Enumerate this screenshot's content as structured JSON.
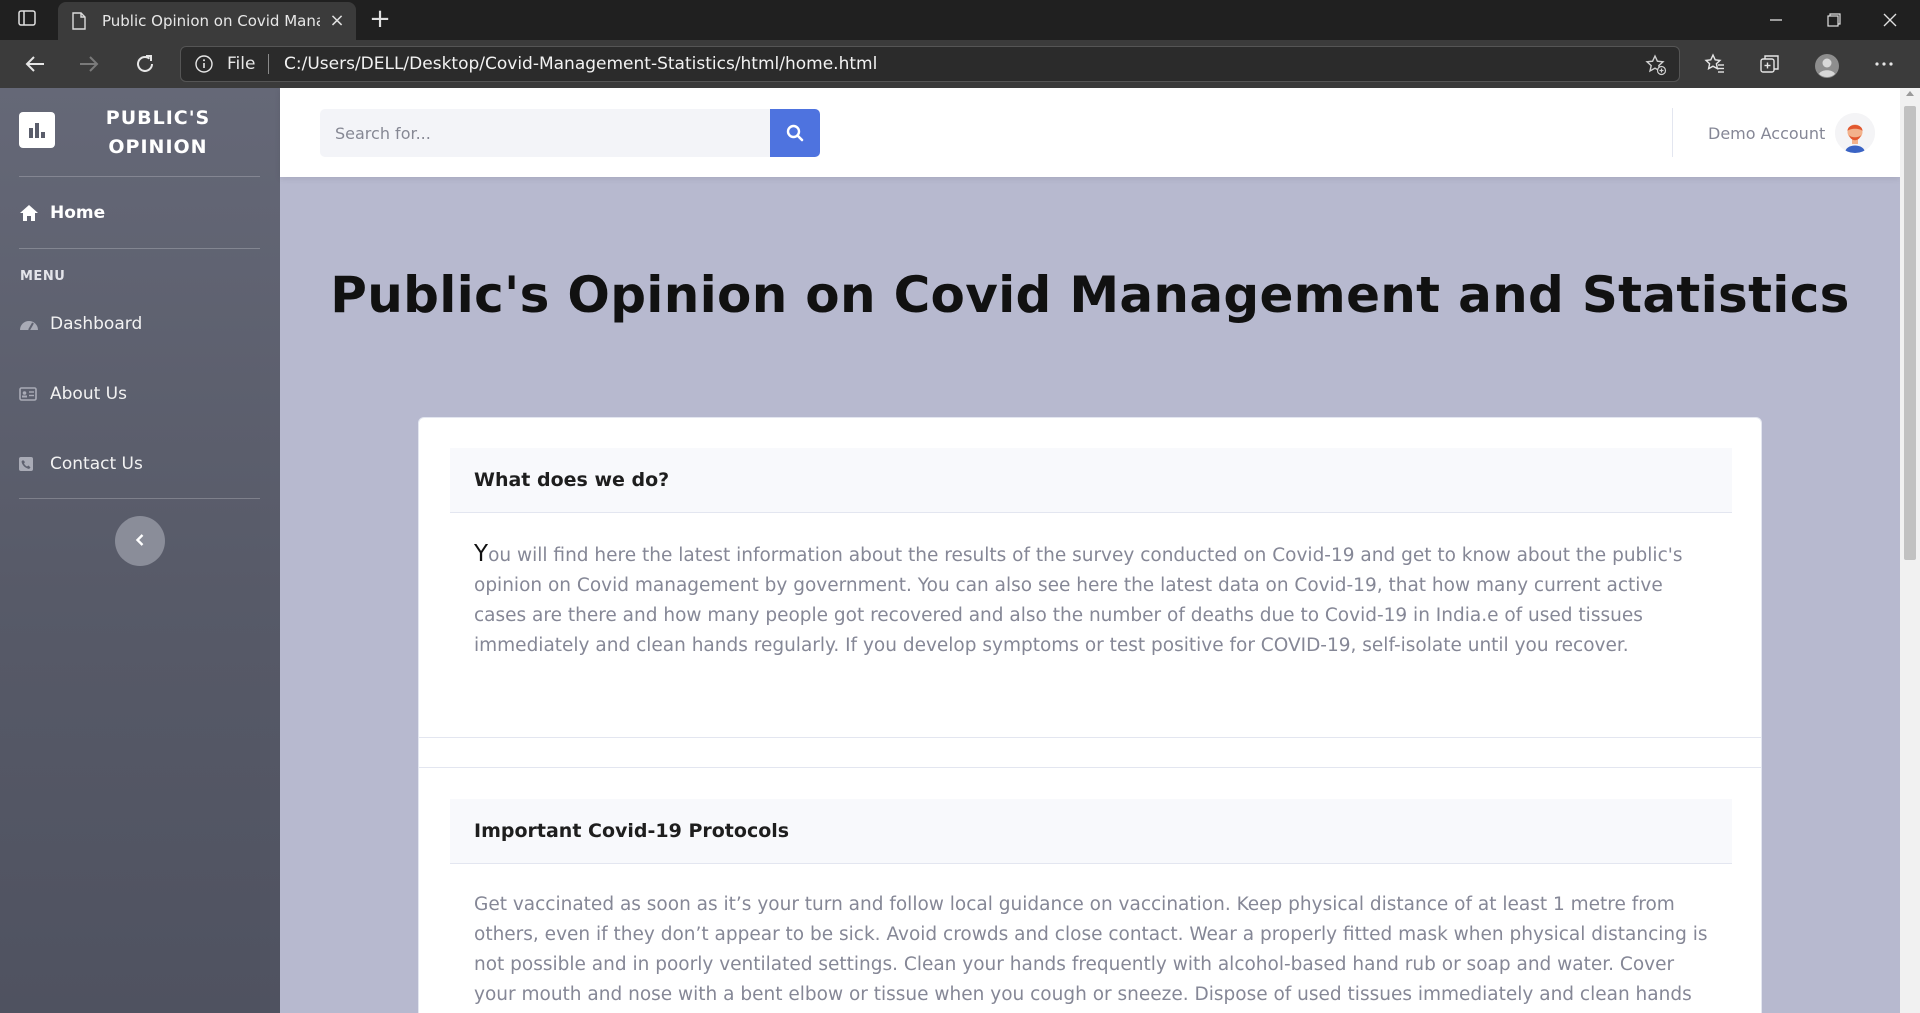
{
  "browser": {
    "tab_title": "Public Opinion on Covid Management and Statistics",
    "address_scheme": "File",
    "address_url": "C:/Users/DELL/Desktop/Covid-Management-Statistics/html/home.html"
  },
  "sidebar": {
    "brand": "PUBLIC'S OPINION",
    "home_label": "Home",
    "menu_heading": "MENU",
    "items": [
      {
        "label": "Dashboard",
        "icon": "tachometer-icon"
      },
      {
        "label": "About Us",
        "icon": "id-card-icon"
      },
      {
        "label": "Contact Us",
        "icon": "phone-square-icon"
      }
    ]
  },
  "topbar": {
    "search_placeholder": "Search for...",
    "user_name": "Demo Account"
  },
  "main": {
    "title": "Public's Opinion on Covid Management and Statistics",
    "sections": [
      {
        "heading": "What does we do?",
        "dropcap": "Y",
        "body": "ou will find here the latest information about the results of the survey conducted on Covid-19 and get to know about the public's opinion on Covid management by government. You can also see here the latest data on Covid-19, that how many current active cases are there and how many people got recovered and also the number of deaths due to Covid-19 in India.e of used tissues immediately and clean hands regularly. If you develop symptoms or test positive for COVID-19, self-isolate until you recover."
      },
      {
        "heading": "Important Covid-19 Protocols",
        "body": "Get vaccinated as soon as it’s your turn and follow local guidance on vaccination. Keep physical distance of at least 1 metre from others, even if they don’t appear to be sick. Avoid crowds and close contact. Wear a properly fitted mask when physical distancing is not possible and in poorly ventilated settings. Clean your hands frequently with alcohol-based hand rub or soap and water. Cover your mouth and nose with a bent elbow or tissue when you cough or sneeze. Dispose of used tissues immediately and clean hands regularly. If you"
      }
    ]
  },
  "colors": {
    "accent": "#4e73df",
    "sidebar": "#5b5e6c",
    "page_background": "#b7b9cf"
  }
}
